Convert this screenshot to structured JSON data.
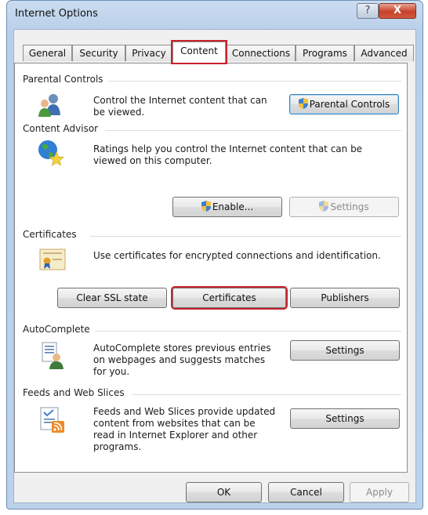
{
  "window": {
    "title": "Internet Options",
    "help_glyph": "?",
    "close_glyph": "X"
  },
  "tabs": [
    {
      "label": "General"
    },
    {
      "label": "Security"
    },
    {
      "label": "Privacy"
    },
    {
      "label": "Content",
      "active": true
    },
    {
      "label": "Connections"
    },
    {
      "label": "Programs"
    },
    {
      "label": "Advanced"
    }
  ],
  "parental": {
    "heading": "Parental Controls",
    "line1": "Control the Internet content that can",
    "line2": "be viewed.",
    "button": "Parental Controls"
  },
  "advisor": {
    "heading": "Content Advisor",
    "line1": "Ratings help you control the Internet content that can be",
    "line2": "viewed on this computer.",
    "enable_button": "Enable...",
    "settings_button": "Settings"
  },
  "certificates": {
    "heading": "Certificates",
    "description": "Use certificates for encrypted connections and identification.",
    "clear_ssl_button": "Clear SSL state",
    "certificates_button": "Certificates",
    "publishers_button": "Publishers"
  },
  "autocomplete": {
    "heading": "AutoComplete",
    "line1": "AutoComplete stores previous entries",
    "line2": "on webpages and suggests matches",
    "line3": "for you.",
    "settings_button": "Settings"
  },
  "feeds": {
    "heading": "Feeds and Web Slices",
    "line1": "Feeds and Web Slices provide updated",
    "line2": "content from websites that can be",
    "line3": "read in Internet Explorer and other",
    "line4": "programs.",
    "settings_button": "Settings"
  },
  "footer": {
    "ok": "OK",
    "cancel": "Cancel",
    "apply": "Apply"
  },
  "colors": {
    "highlight": "#c8232c",
    "title_bar": "#b9cfe9",
    "close_button": "#c7412a"
  }
}
